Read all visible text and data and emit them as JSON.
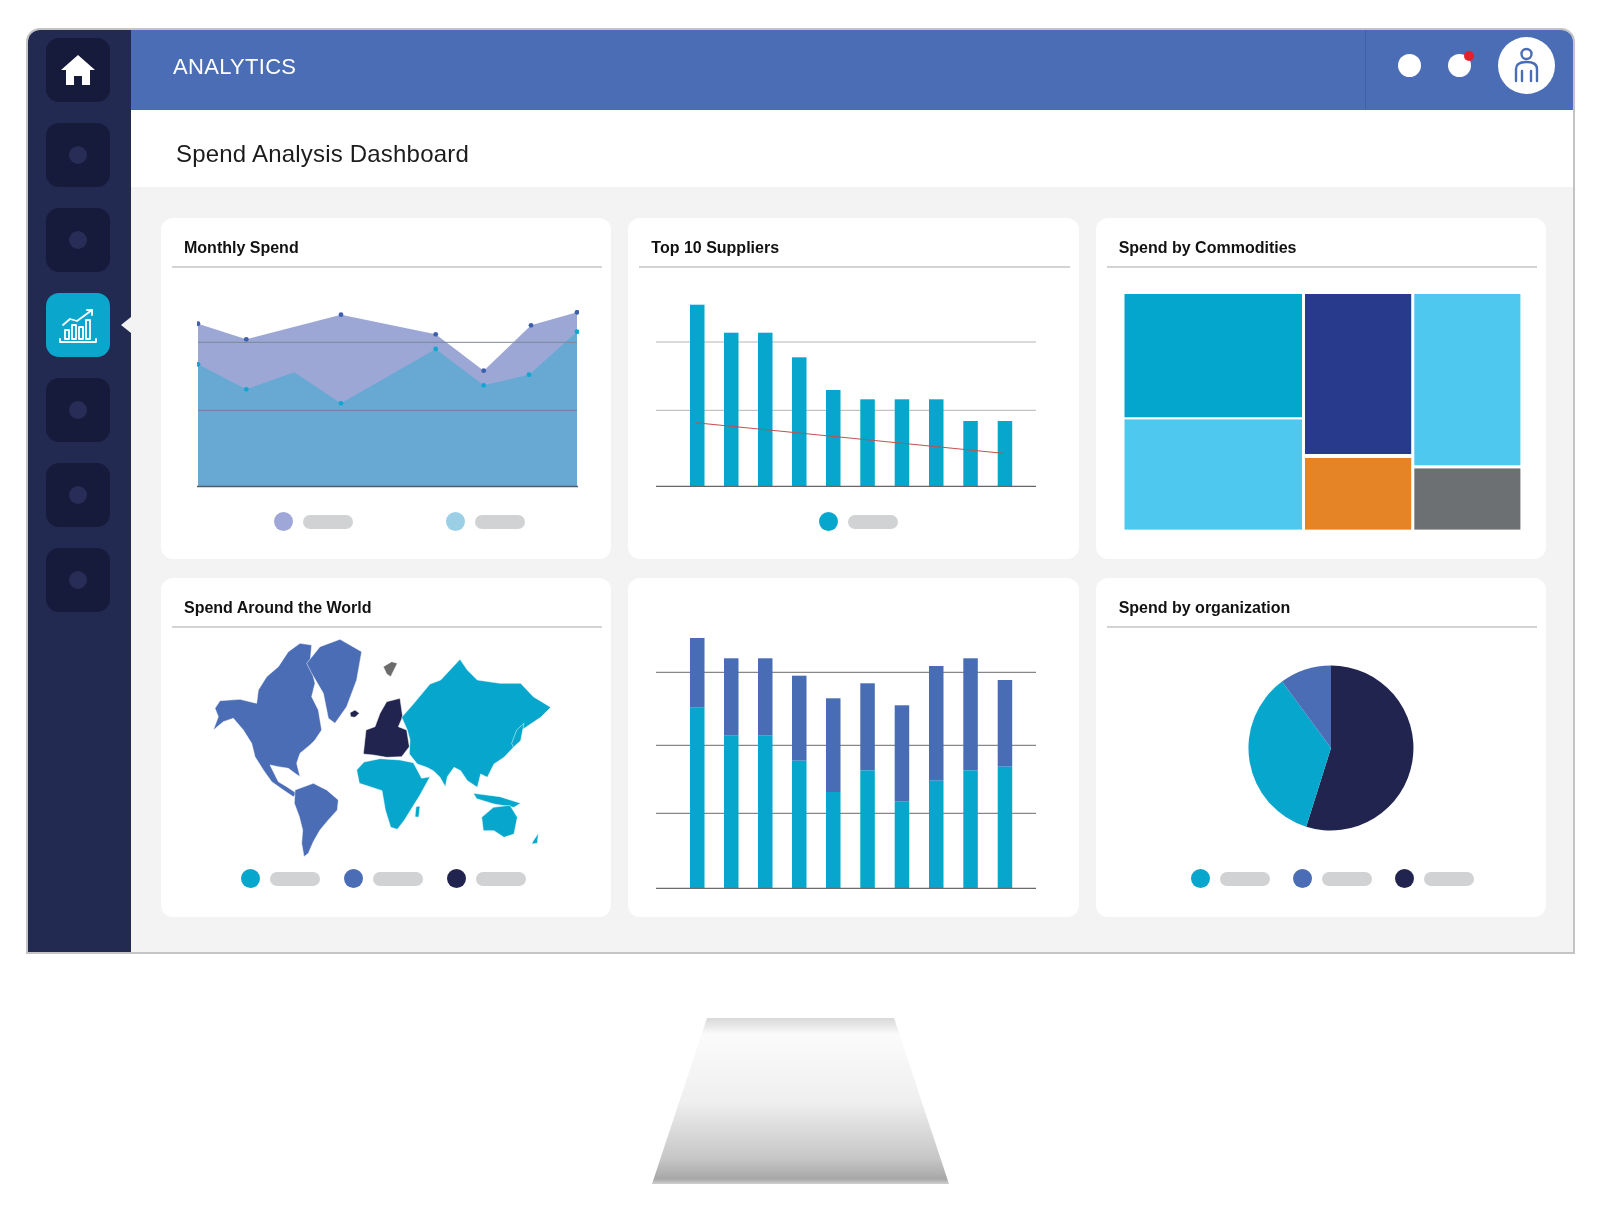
{
  "sidebar": {
    "items": [
      {
        "kind": "home",
        "selected": false
      },
      {
        "kind": "blank",
        "selected": false
      },
      {
        "kind": "blank",
        "selected": false
      },
      {
        "kind": "chart",
        "selected": true
      },
      {
        "kind": "blank",
        "selected": false
      },
      {
        "kind": "blank",
        "selected": false
      },
      {
        "kind": "blank",
        "selected": false
      }
    ]
  },
  "header": {
    "title": "ANALYTICS",
    "icons": [
      {
        "kind": "dot",
        "alert": false
      },
      {
        "kind": "dot",
        "alert": true
      },
      {
        "kind": "avatar",
        "alert": false
      }
    ]
  },
  "title_bar": {
    "title": "Spend Analysis Dashboard"
  },
  "cards": [
    {
      "title": "Monthly Spend",
      "kind": "area",
      "legend": [
        {
          "color": "#9ea7d7"
        },
        {
          "color": "#9bcfe6"
        }
      ]
    },
    {
      "title": "Top 10 Suppliers",
      "kind": "bar",
      "legend": [
        {
          "color": "#07a6cc"
        }
      ]
    },
    {
      "title": "Spend by Commodities",
      "kind": "treemap"
    },
    {
      "title": "Spend Around the World",
      "kind": "map",
      "legend": [
        {
          "color": "#07a6cc"
        },
        {
          "color": "#4a6db5"
        },
        {
          "color": "#20244e"
        }
      ]
    },
    {
      "kind": "stacked"
    },
    {
      "title": "Spend by organization",
      "kind": "pie",
      "legend": [
        {
          "color": "#07a6cc"
        },
        {
          "color": "#4a6db5"
        },
        {
          "color": "#20244e"
        }
      ]
    }
  ]
}
